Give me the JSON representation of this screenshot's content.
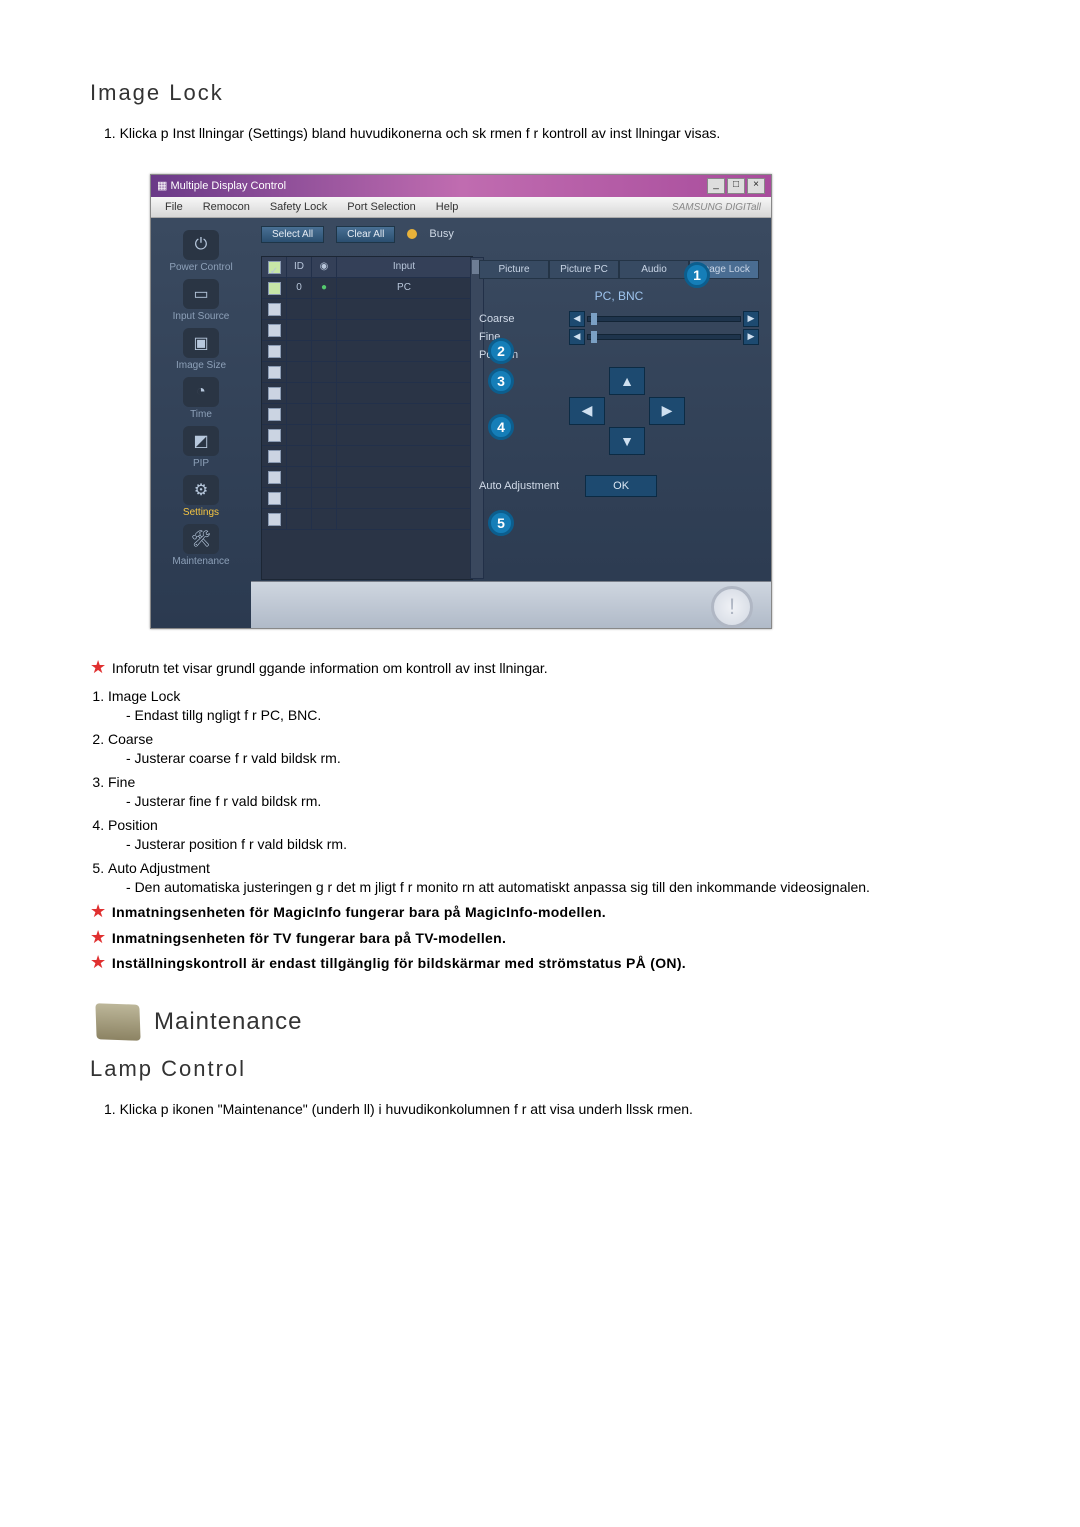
{
  "section": {
    "title": "Image Lock"
  },
  "step1": "1.  Klicka p  Inst llningar (Settings)   bland huvudikonerna och sk rmen f r kontroll av inst llningar visas.",
  "app": {
    "title": "Multiple Display Control",
    "brand": "SAMSUNG DIGITall",
    "menu": {
      "file": "File",
      "remocon": "Remocon",
      "safety": "Safety Lock",
      "port": "Port Selection",
      "help": "Help"
    },
    "sidebar": {
      "power": "Power Control",
      "input": "Input Source",
      "image": "Image Size",
      "time": "Time",
      "pip": "PIP",
      "settings": "Settings",
      "maint": "Maintenance"
    },
    "toolbar": {
      "select_all": "Select All",
      "clear_all": "Clear All",
      "busy": "Busy"
    },
    "table": {
      "hdr_id": "ID",
      "hdr_input": "Input",
      "row0_id": "0",
      "row0_input": "PC"
    },
    "panel": {
      "tabs": {
        "picture": "Picture",
        "picture_pc": "Picture PC",
        "audio": "Audio",
        "image_lock": "Image Lock"
      },
      "mode": "PC, BNC",
      "coarse": "Coarse",
      "fine": "Fine",
      "position": "Position",
      "auto": "Auto Adjustment",
      "ok": "OK"
    }
  },
  "notes": {
    "intro": "Inforutn tet visar grundl ggande information om kontroll av inst llningar.",
    "item1_t": "Image Lock",
    "item1_d": "- Endast tillg ngligt f r PC, BNC.",
    "item2_t": "Coarse",
    "item2_d": "- Justerar coarse f r vald bildsk rm.",
    "item3_t": "Fine",
    "item3_d": "- Justerar fine f r vald bildsk rm.",
    "item4_t": "Position",
    "item4_d": "- Justerar position f r vald bildsk rm.",
    "item5_t": "Auto Adjustment",
    "item5_d": "Den automatiska justeringen g r det m jligt f r monito     rn att automatiskt anpassa sig till den inkommande videosignalen.",
    "warn1": "Inmatningsenheten för MagicInfo fungerar bara på MagicInfo-modellen.",
    "warn2": "Inmatningsenheten för TV fungerar bara på TV-modellen.",
    "warn3": "Inställningskontroll är endast tillgänglig för bildskärmar med strömstatus PÅ (ON)."
  },
  "maintenance": {
    "title": "Maintenance",
    "sub": "Lamp Control",
    "step": "1.  Klicka p  ikonen \"Maintenance\" (underh ll) i huvudikonkolumnen f r att visa underh llssk rmen."
  }
}
